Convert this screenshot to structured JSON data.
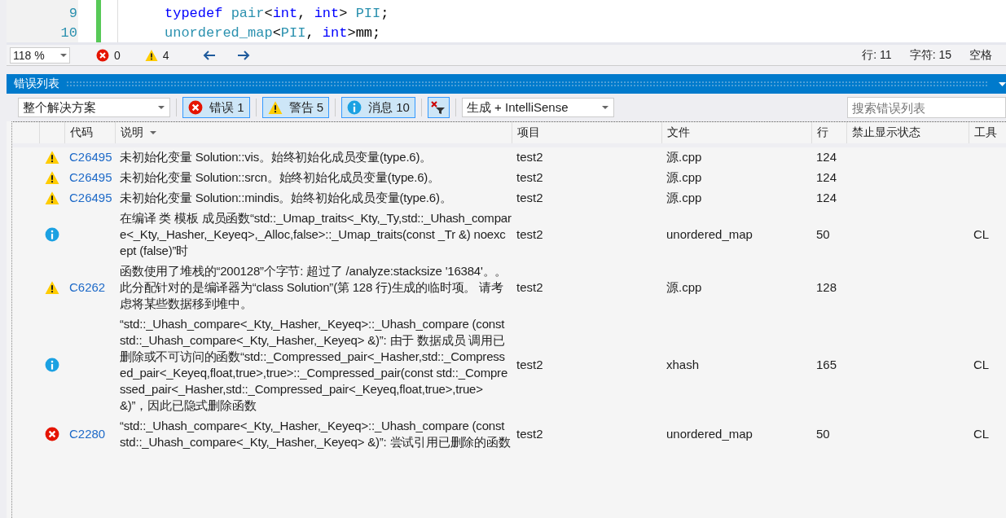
{
  "editor": {
    "lines": [
      {
        "number": "9",
        "tokens": [
          {
            "kind": "keyword",
            "text": "typedef "
          },
          {
            "kind": "type",
            "text": "pair"
          },
          {
            "kind": "plain",
            "text": "<"
          },
          {
            "kind": "keyword",
            "text": "int"
          },
          {
            "kind": "plain",
            "text": ", "
          },
          {
            "kind": "keyword",
            "text": "int"
          },
          {
            "kind": "plain",
            "text": "> "
          },
          {
            "kind": "type",
            "text": "PII"
          },
          {
            "kind": "plain",
            "text": ";"
          }
        ]
      },
      {
        "number": "10",
        "tokens": [
          {
            "kind": "type",
            "text": "unordered_map"
          },
          {
            "kind": "plain",
            "text": "<"
          },
          {
            "kind": "type",
            "text": "PII"
          },
          {
            "kind": "plain",
            "text": ", "
          },
          {
            "kind": "keyword",
            "text": "int"
          },
          {
            "kind": "plain",
            "text": ">mm;"
          }
        ]
      }
    ]
  },
  "status_bar": {
    "zoom": "118 %",
    "errors": "0",
    "warnings": "4",
    "line": "行: 11",
    "char": "字符: 15",
    "indent": "空格"
  },
  "error_list": {
    "title": "错误列表",
    "scope": "整个解决方案",
    "filters": [
      {
        "kind": "error",
        "label": "错误 1",
        "selected": true
      },
      {
        "kind": "warning",
        "label": "警告 5",
        "selected": true
      },
      {
        "kind": "info",
        "label": "消息 10",
        "selected": true
      }
    ],
    "source": "生成 + IntelliSense",
    "search": {
      "placeholder": "搜索错误列表"
    },
    "columns": [
      "代码",
      "说明",
      "项目",
      "文件",
      "行",
      "禁止显示状态",
      "工具"
    ],
    "rows": [
      {
        "kind": "warning",
        "code": "C26495",
        "description": "未初始化变量 Solution::vis。始终初始化成员变量(type.6)。",
        "project": "test2",
        "file": "源.cpp",
        "line": "124"
      },
      {
        "kind": "warning",
        "code": "C26495",
        "description": "未初始化变量 Solution::srcn。始终初始化成员变量(type.6)。",
        "project": "test2",
        "file": "源.cpp",
        "line": "124"
      },
      {
        "kind": "warning",
        "code": "C26495",
        "description": "未初始化变量 Solution::mindis。始终初始化成员变量(type.6)。",
        "project": "test2",
        "file": "源.cpp",
        "line": "124"
      },
      {
        "kind": "info",
        "description": "在编译 类 模板 成员函数“std::_Umap_traits<_Kty,_Ty,std::_Uhash_compare<_Kty,_Hasher,_Keyeq>,_Alloc,false>::_Umap_traits(const _Tr &) noexcept (false)”时",
        "project": "test2",
        "file": "unordered_map",
        "line": "50",
        "tool": "CL"
      },
      {
        "kind": "warning",
        "code": "C6262",
        "description": "函数使用了堆栈的“200128”个字节: 超过了 /analyze:stacksize '16384'。。此分配针对的是编译器为“class Solution”(第 128 行)生成的临时项。 请考虑将某些数据移到堆中。",
        "project": "test2",
        "file": "源.cpp",
        "line": "128"
      },
      {
        "kind": "info",
        "description": "“std::_Uhash_compare<_Kty,_Hasher,_Keyeq>::_Uhash_compare (const std::_Uhash_compare<_Kty,_Hasher,_Keyeq> &)”: 由于 数据成员 调用已删除或不可访问的函数“std::_Compressed_pair<_Hasher,std::_Compressed_pair<_Keyeq,float,true>,true>::_Compressed_pair(const std::_Compressed_pair<_Hasher,std::_Compressed_pair<_Keyeq,float,true>,true> &)”，因此已隐式删除函数",
        "project": "test2",
        "file": "xhash",
        "line": "165",
        "tool": "CL"
      },
      {
        "kind": "error",
        "code": "C2280",
        "description": "“std::_Uhash_compare<_Kty,_Hasher,_Keyeq>::_Uhash_compare (const std::_Uhash_compare<_Kty,_Hasher,_Keyeq> &)”: 尝试引用已删除的函数",
        "project": "test2",
        "file": "unordered_map",
        "line": "50",
        "tool": "CL"
      }
    ]
  }
}
